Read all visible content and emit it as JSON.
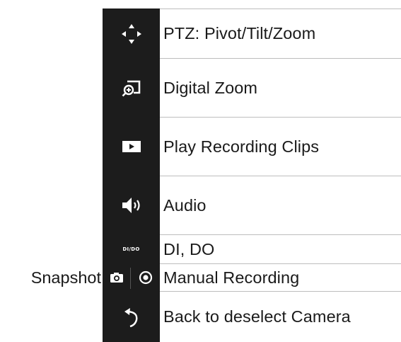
{
  "items": [
    {
      "icon": "move-arrows-icon",
      "label": "PTZ: Pivot/Tilt/Zoom"
    },
    {
      "icon": "digital-zoom-icon",
      "label": "Digital Zoom"
    },
    {
      "icon": "play-icon",
      "label": "Play Recording Clips"
    },
    {
      "icon": "speaker-icon",
      "label": "Audio"
    },
    {
      "icon": "di-do-icon",
      "icon_text": "DI/DO",
      "label": "DI, DO"
    },
    {
      "icon": "record-icon",
      "label": "Manual Recording"
    },
    {
      "icon": "back-arrow-icon",
      "label": "Back to deselect Camera"
    }
  ],
  "snapshot": {
    "icon": "camera-icon",
    "label": "Snapshot"
  },
  "colors": {
    "icon_bar": "#1c1c1c",
    "icon_fg": "#ffffff",
    "divider": "#bdbdbd",
    "text": "#1a1a1a"
  }
}
